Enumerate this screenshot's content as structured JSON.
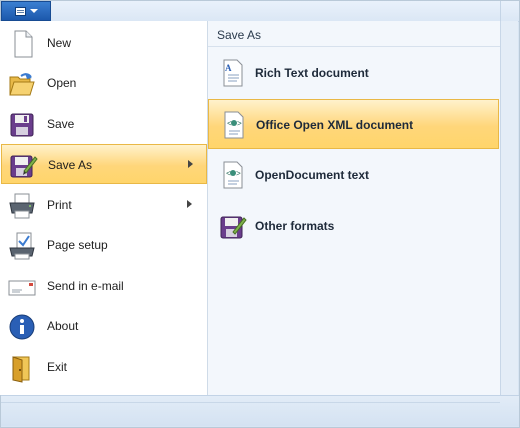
{
  "menu": {
    "items": [
      {
        "label": "New",
        "icon": "new-document-icon"
      },
      {
        "label": "Open",
        "icon": "open-folder-icon"
      },
      {
        "label": "Save",
        "icon": "floppy-disk-icon"
      },
      {
        "label": "Save As",
        "icon": "save-as-icon",
        "selected": true,
        "has_submenu": true
      },
      {
        "label": "Print",
        "icon": "printer-icon",
        "has_submenu": true
      },
      {
        "label": "Page setup",
        "icon": "page-setup-icon"
      },
      {
        "label": "Send in e-mail",
        "icon": "envelope-icon"
      },
      {
        "label": "About",
        "icon": "info-icon"
      },
      {
        "label": "Exit",
        "icon": "exit-door-icon"
      }
    ]
  },
  "submenu": {
    "title": "Save As",
    "items": [
      {
        "label": "Rich Text document",
        "icon": "rtf-document-icon"
      },
      {
        "label": "Office Open XML document",
        "icon": "xml-document-icon",
        "selected": true
      },
      {
        "label": "OpenDocument text",
        "icon": "odt-document-icon"
      },
      {
        "label": "Other formats",
        "icon": "floppy-disk-pen-icon"
      }
    ]
  },
  "colors": {
    "highlight_top": "#fff2cc",
    "highlight_bottom": "#ffd56b",
    "highlight_border": "#e9b846",
    "app_button": "#2b6cc2"
  }
}
